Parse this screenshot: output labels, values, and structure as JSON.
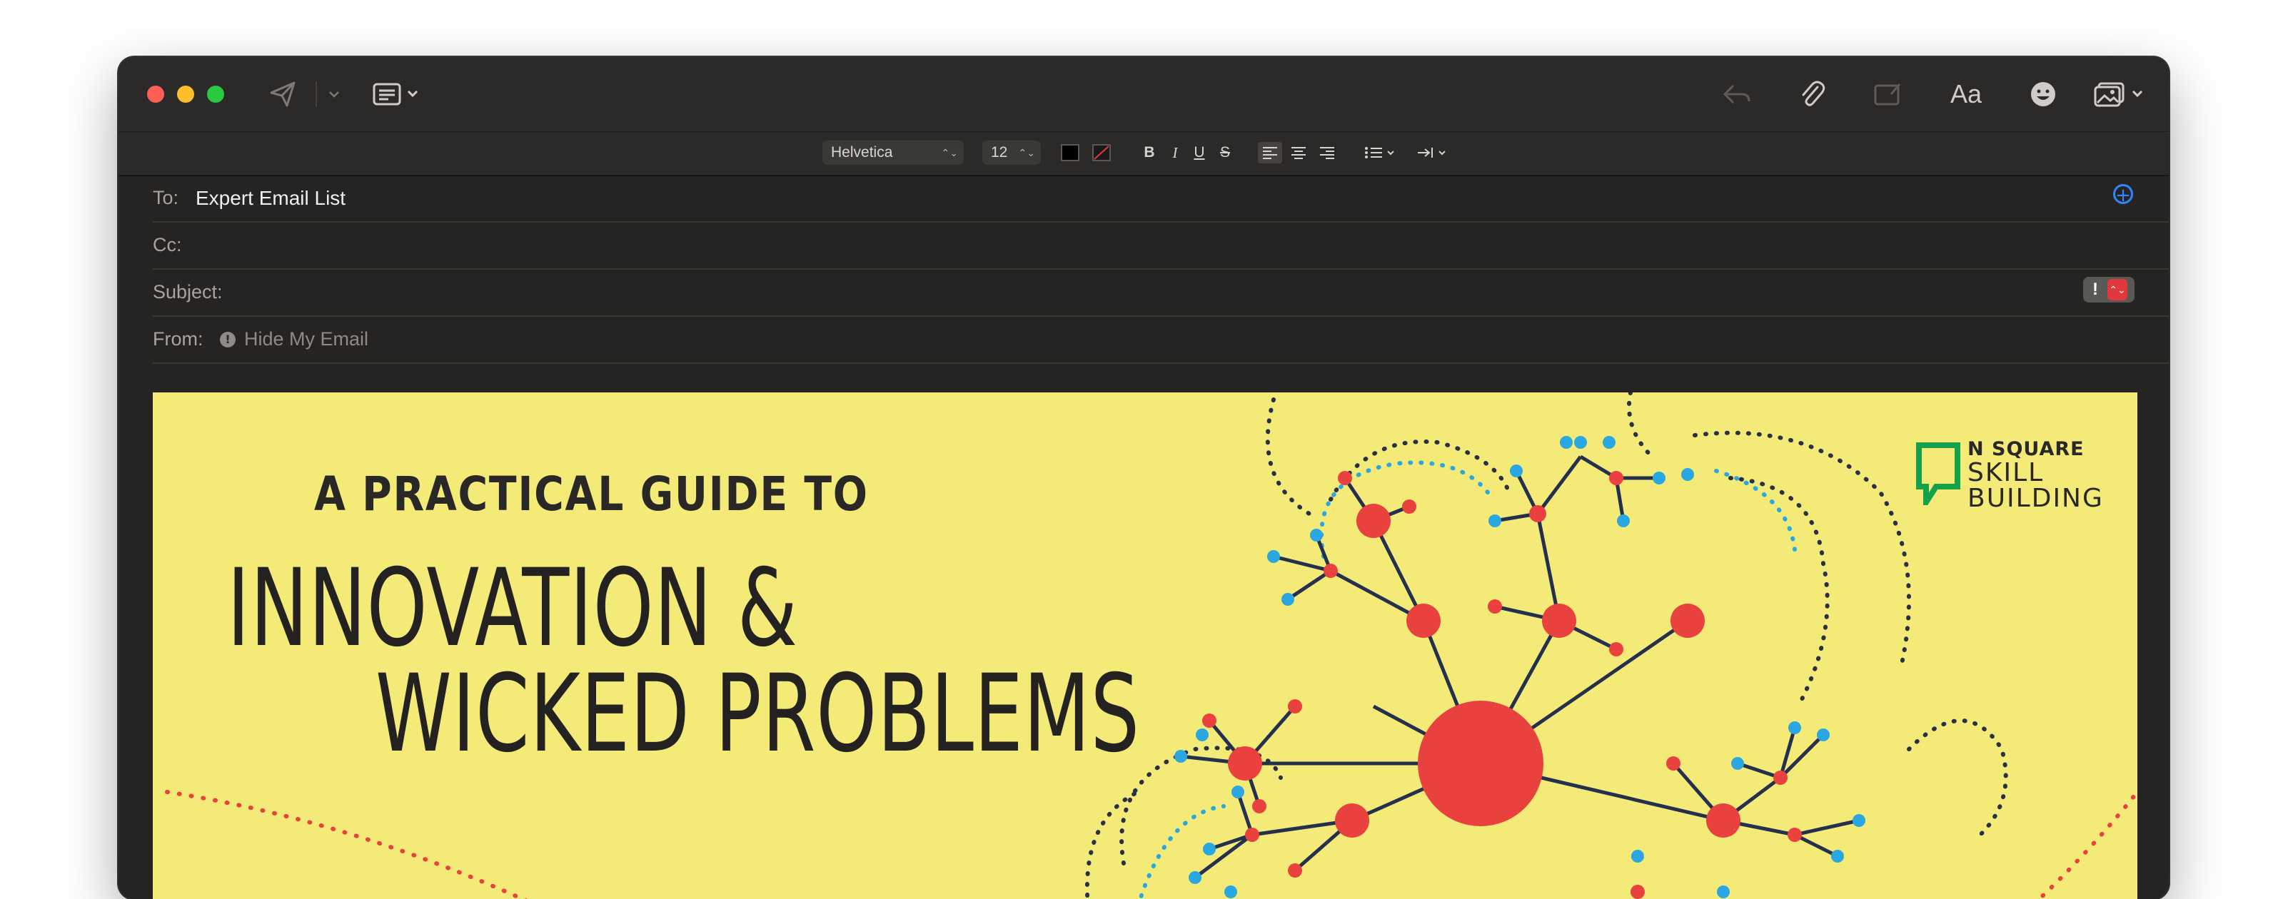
{
  "toolbar": {
    "icons": [
      "send-icon",
      "chevron-down-icon",
      "header-fields-icon",
      "reply-icon",
      "paperclip-icon",
      "markup-icon",
      "font-panel-icon",
      "emoji-icon",
      "photo-browser-icon"
    ],
    "format_label": "Aa"
  },
  "format_bar": {
    "font": "Helvetica",
    "size": "12",
    "bold": "B",
    "italic": "I",
    "underline": "U",
    "strikethrough": "S"
  },
  "fields": {
    "to_label": "To:",
    "to_value": "Expert Email List",
    "cc_label": "Cc:",
    "cc_value": "",
    "subject_label": "Subject:",
    "subject_value": "",
    "from_label": "From:",
    "from_value": "Hide My Email",
    "priority_symbol": "!"
  },
  "banner": {
    "kicker": "A PRACTICAL GUIDE TO",
    "title_line1": "INNOVATION &",
    "title_line2": "WICKED PROBLEMS",
    "logo_line1": "N SQUARE",
    "logo_line2": "SKILL",
    "logo_line3": "BUILDING"
  },
  "colors": {
    "window_bg": "#262422",
    "banner_bg": "#f3ea78",
    "node_red": "#e8413e",
    "node_blue": "#2aa7e0",
    "logo_green": "#15a04a",
    "add_button_blue": "#2f86ff"
  }
}
